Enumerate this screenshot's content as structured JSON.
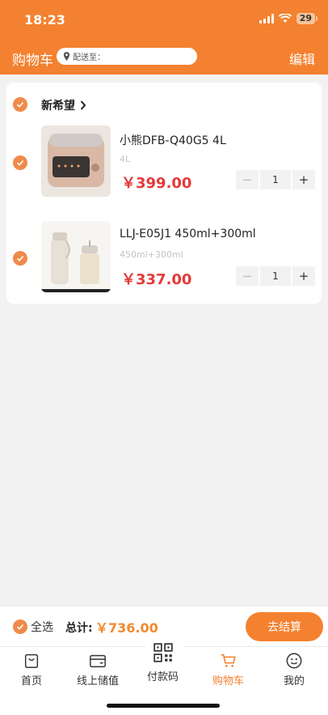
{
  "status": {
    "time": "18:23",
    "battery": "29"
  },
  "header": {
    "title": "购物车",
    "address_placeholder": "配送至：",
    "edit_label": "编辑"
  },
  "store": {
    "name": "新希望"
  },
  "items": [
    {
      "name": "小熊DFB-Q40G5 4L",
      "spec": "4L",
      "price": "￥399.00",
      "qty": "1"
    },
    {
      "name": "LLJ-E05J1 450ml+300ml",
      "spec": "450ml+300ml",
      "price": "￥337.00",
      "qty": "1"
    }
  ],
  "footer": {
    "select_all": "全选",
    "total_label": "总计:",
    "total_value": "￥736.00",
    "checkout": "去结算"
  },
  "tabs": [
    {
      "label": "首页",
      "icon": "bag-icon"
    },
    {
      "label": "线上储值",
      "icon": "wallet-icon"
    },
    {
      "label": "付款码",
      "icon": "qr-code-icon"
    },
    {
      "label": "购物车",
      "icon": "cart-icon",
      "active": true
    },
    {
      "label": "我的",
      "icon": "smiley-icon"
    }
  ],
  "colors": {
    "accent": "#f4812f",
    "price": "#e43a3a",
    "check": "#f08a4b"
  }
}
